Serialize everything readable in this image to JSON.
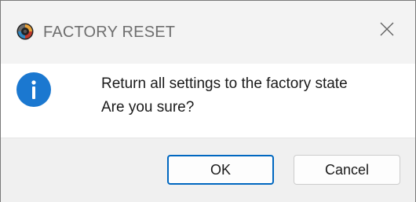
{
  "window": {
    "title": "FACTORY RESET",
    "app_icon": "app-logo-icon",
    "close_icon": "close-icon"
  },
  "message": {
    "icon": "info-icon",
    "icon_color": "#1b78d0",
    "line1": "Return all settings to the factory state",
    "line2": "Are you sure?"
  },
  "buttons": {
    "ok_label": "OK",
    "cancel_label": "Cancel",
    "ok_border_color": "#0067c0"
  }
}
